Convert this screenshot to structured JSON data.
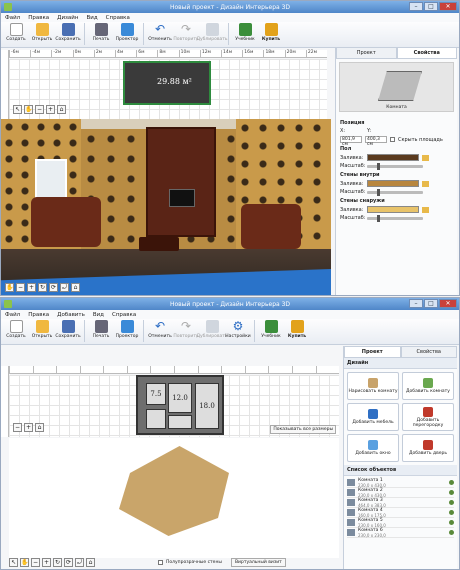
{
  "top": {
    "title": "Новый проект - Дизайн Интерьера 3D",
    "menu": [
      "Файл",
      "Правка",
      "Дизайн",
      "Вид",
      "Справка"
    ],
    "toolbar": [
      "Создать",
      "Открыть",
      "Сохранить",
      "Печать",
      "Проектор",
      "Отменить",
      "Повторить",
      "Дублировать",
      "Учебник",
      "Купить"
    ],
    "ruler": [
      "-6м",
      "-4м",
      "-2м",
      "0м",
      "2м",
      "4м",
      "6м",
      "8м",
      "10м",
      "12м",
      "14м",
      "16м",
      "18м",
      "20м",
      "22м"
    ],
    "room_area": "29.88 м²",
    "tabs": [
      "Проект",
      "Свойства"
    ],
    "preview_caption": "Комната",
    "position": {
      "title": "Позиция",
      "x_label": "X:",
      "y_label": "Y:",
      "x": "801,9 см",
      "y": "400,3 см",
      "hide_area": "Скрыть площадь"
    },
    "floor": {
      "title": "Пол",
      "fill": "Заливка:",
      "scale": "Масштаб:"
    },
    "walls_in": {
      "title": "Стены внутри",
      "fill": "Заливка:",
      "scale": "Масштаб:"
    },
    "walls_out": {
      "title": "Стены снаружи",
      "fill": "Заливка:",
      "scale": "Масштаб:"
    }
  },
  "bottom": {
    "title": "Новый проект - Дизайн Интерьера 3D",
    "menu": [
      "Файл",
      "Правка",
      "Добавить",
      "Вид",
      "Справка"
    ],
    "toolbar": [
      "Создать",
      "Открыть",
      "Сохранить",
      "Печать",
      "Проектор",
      "Отменить",
      "Повторить",
      "Дублировать",
      "Настройки",
      "Учебник",
      "Купить"
    ],
    "room_labels": [
      "7.5",
      "12.0",
      "18.0"
    ],
    "show_sizes": "Показывать все размеры",
    "tabs": [
      "Проект",
      "Свойства"
    ],
    "design_title": "Дизайн",
    "big_buttons": [
      "Нарисовать комнату",
      "Добавить комнату",
      "Добавить мебель",
      "Добавить перегородку",
      "Добавить окно",
      "Добавить дверь"
    ],
    "objects_title": "Список объектов",
    "objects": [
      {
        "name": "Комната 1",
        "size": "230,0 x 430,0"
      },
      {
        "name": "Комната 2",
        "size": "230,0 x 430,0"
      },
      {
        "name": "Комната 3",
        "size": "464,0 x 383,0"
      },
      {
        "name": "Комната 4",
        "size": "160,0 x 175,0"
      },
      {
        "name": "Комната 5",
        "size": "230,0 x 160,0"
      },
      {
        "name": "Комната 6",
        "size": "230,0 x 230,0"
      }
    ],
    "translucent_walls": "Полупрозрачные стены",
    "virtual_visit": "Виртуальный визит"
  },
  "colors": {
    "accent": "#4f86c8",
    "wallpaper": "#c99a4a",
    "floor": "#4a3a30",
    "selection": "#2e8b3e"
  }
}
